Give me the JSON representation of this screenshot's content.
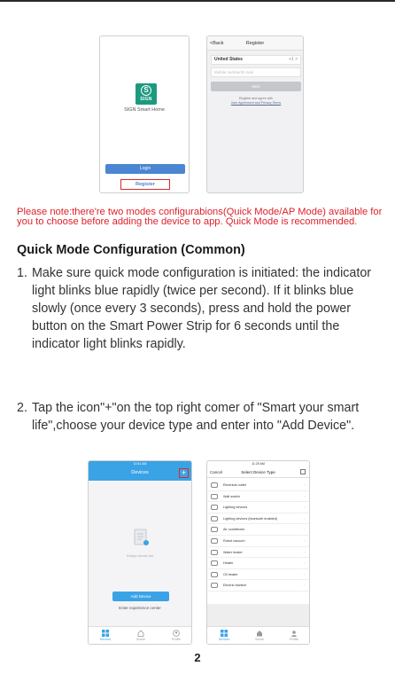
{
  "login_screen": {
    "logo_letter": "S",
    "logo_text": "SIGN",
    "brand": "SIGN Smart Home",
    "login_label": "Login",
    "register_label": "Register"
  },
  "register_screen": {
    "back_label": "<Back",
    "title": "Register",
    "country": "United States",
    "country_code": "+1 >",
    "input_placeholder": "Mobile number/E-mail",
    "next_label": "Next",
    "agree_text": "Register and agree with",
    "agree_link": "User Agreement and Privacy Terms"
  },
  "note": "Please note:there're two modes configurabions(Quick Mode/AP Mode) available for you to choose before adding the device to app. Quick Mode is recommended.",
  "heading": "Quick Mode Configuration (Common)",
  "steps": [
    {
      "num": "1.",
      "text": "Make sure quick mode configuration is initiated: the indicator light blinks blue rapidly (twice per second). If it blinks blue slowly (once every 3 seconds), press and hold the power button on the Smart Power Strip for 6 seconds until the indicator light blinks rapidly."
    },
    {
      "num": "2.",
      "text": "Tap the icon\"+\"on the top right comer of \"Smart your smart life\",choose your device type and enter into \"Add Device\"."
    }
  ],
  "devices_screen": {
    "status": "10:41 AM",
    "title": "Devices",
    "plus_label": "+",
    "empty_text": "Empty device list",
    "add_label": "Add Device",
    "experience_label": "Enter experience center",
    "tabs": [
      "Devices",
      "Scene",
      "Profile"
    ]
  },
  "select_screen": {
    "status": "11:29 AM",
    "cancel_label": "Cancel",
    "title": "Select Device Type",
    "items": [
      "Electrical outlet",
      "Wall switch",
      "Lighting devices",
      "Lighting devices (bluetooth enabled)",
      "Air conditioner",
      "Robot vacuum",
      "Water heater",
      "Heater",
      "Oil heater",
      "Electric blanket"
    ],
    "tabs": [
      "Devices",
      "Scene",
      "Profile"
    ]
  },
  "page_number": "2",
  "colors": {
    "note_red": "#e0202a",
    "app_blue": "#3aa3e6",
    "brand_green": "#1c9a80"
  }
}
